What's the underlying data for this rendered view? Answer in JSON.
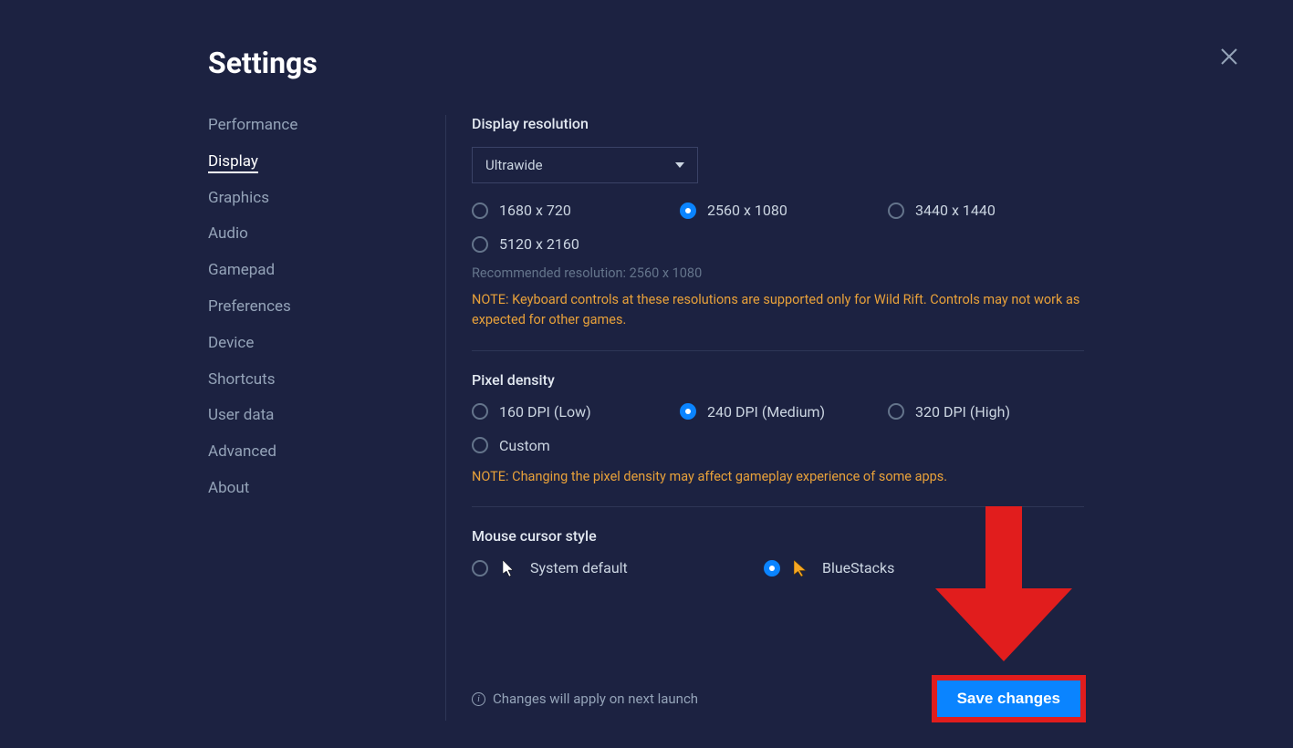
{
  "title": "Settings",
  "sidebar": {
    "items": [
      {
        "label": "Performance",
        "active": false
      },
      {
        "label": "Display",
        "active": true
      },
      {
        "label": "Graphics",
        "active": false
      },
      {
        "label": "Audio",
        "active": false
      },
      {
        "label": "Gamepad",
        "active": false
      },
      {
        "label": "Preferences",
        "active": false
      },
      {
        "label": "Device",
        "active": false
      },
      {
        "label": "Shortcuts",
        "active": false
      },
      {
        "label": "User data",
        "active": false
      },
      {
        "label": "Advanced",
        "active": false
      },
      {
        "label": "About",
        "active": false
      }
    ]
  },
  "display": {
    "resolution": {
      "title": "Display resolution",
      "select_value": "Ultrawide",
      "options": [
        {
          "label": "1680 x 720",
          "checked": false
        },
        {
          "label": "2560 x 1080",
          "checked": true
        },
        {
          "label": "3440 x 1440",
          "checked": false
        },
        {
          "label": "5120 x 2160",
          "checked": false
        }
      ],
      "hint": "Recommended resolution: 2560 x 1080",
      "note": "NOTE: Keyboard controls at these resolutions are supported only for Wild Rift. Controls may not work as expected for other games."
    },
    "density": {
      "title": "Pixel density",
      "options": [
        {
          "label": "160 DPI (Low)",
          "checked": false
        },
        {
          "label": "240 DPI (Medium)",
          "checked": true
        },
        {
          "label": "320 DPI (High)",
          "checked": false
        },
        {
          "label": "Custom",
          "checked": false
        }
      ],
      "note": "NOTE: Changing the pixel density may affect gameplay experience of some apps."
    },
    "cursor": {
      "title": "Mouse cursor style",
      "options": [
        {
          "label": "System default",
          "checked": false
        },
        {
          "label": "BlueStacks",
          "checked": true
        }
      ]
    }
  },
  "footer": {
    "apply_hint": "Changes will apply on next launch",
    "save_label": "Save changes"
  }
}
